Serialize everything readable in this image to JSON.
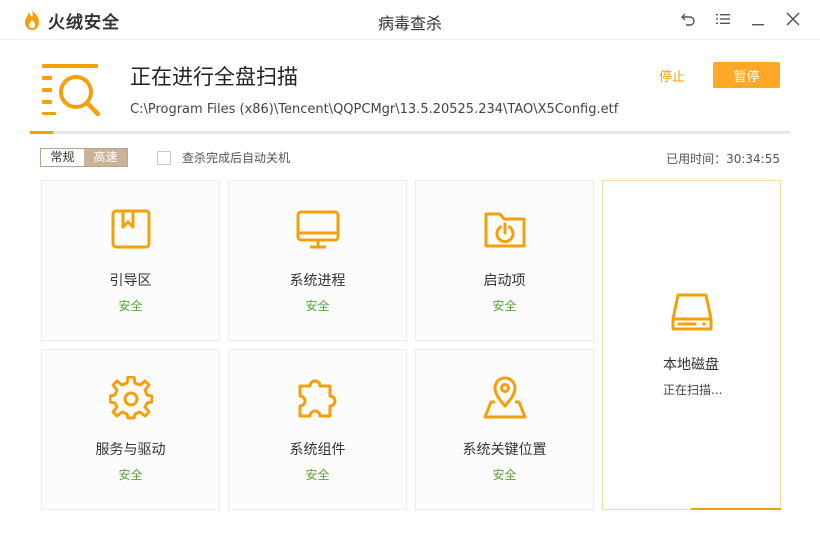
{
  "app": {
    "name": "火绒安全",
    "window_title": "病毒查杀"
  },
  "colors": {
    "accent": "#f5a00a",
    "safe": "#5ba23a",
    "pause_button": "#ffa726"
  },
  "scan": {
    "title": "正在进行全盘扫描",
    "current_path": "C:\\Program Files (x86)\\Tencent\\QQPCMgr\\13.5.20525.234\\TAO\\X5Config.etf",
    "progress_fraction": 0.03,
    "stop_label": "停止",
    "pause_label": "暂停"
  },
  "options": {
    "mode_normal": "常规",
    "mode_fast": "高速",
    "auto_shutdown_label": "查杀完成后自动关机",
    "auto_shutdown_checked": false,
    "elapsed_label": "已用时间：30:34:55"
  },
  "cards": [
    {
      "name": "引导区",
      "status": "安全",
      "icon": "bookmark-icon"
    },
    {
      "name": "系统进程",
      "status": "安全",
      "icon": "monitor-icon"
    },
    {
      "name": "启动项",
      "status": "安全",
      "icon": "power-folder-icon"
    },
    {
      "name": "服务与驱动",
      "status": "安全",
      "icon": "gear-icon"
    },
    {
      "name": "系统组件",
      "status": "安全",
      "icon": "puzzle-icon"
    },
    {
      "name": "系统关键位置",
      "status": "安全",
      "icon": "location-pin-icon"
    },
    {
      "name": "本地磁盘",
      "status": "正在扫描...",
      "icon": "hard-disk-icon"
    }
  ]
}
